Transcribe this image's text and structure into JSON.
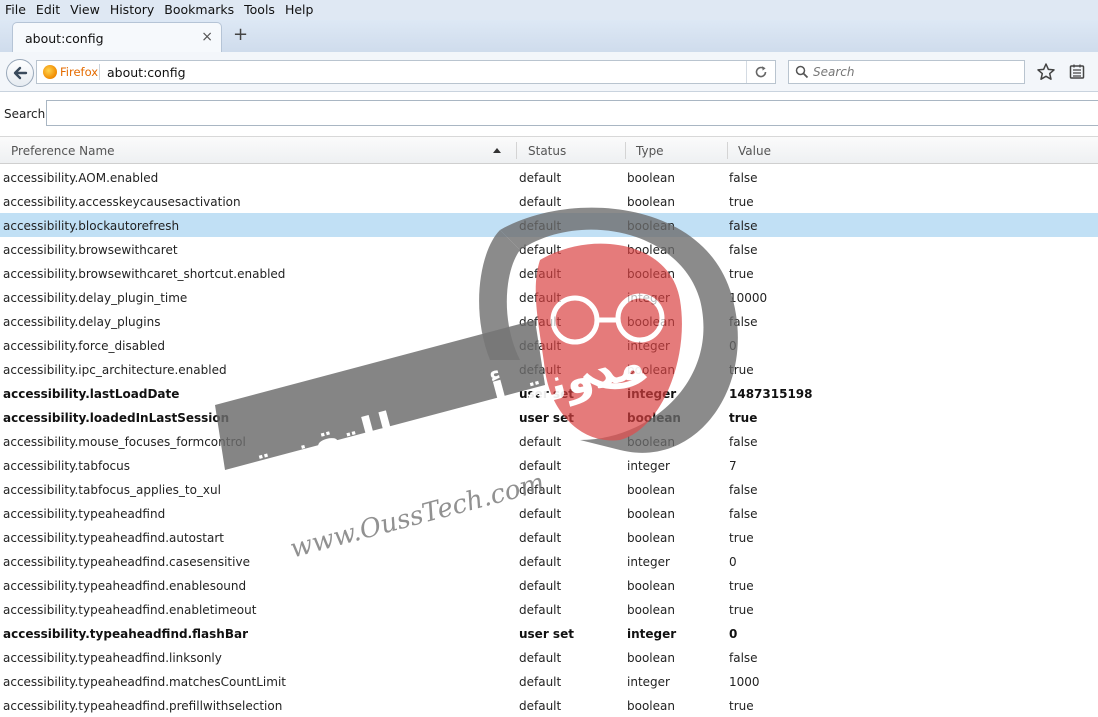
{
  "menu": [
    "File",
    "Edit",
    "View",
    "History",
    "Bookmarks",
    "Tools",
    "Help"
  ],
  "tab": {
    "title": "about:config",
    "close": "×",
    "new_tab": "+"
  },
  "navbar": {
    "identity_label": "Firefox",
    "url": "about:config",
    "search_placeholder": "Search"
  },
  "config_search": {
    "label": "Search:",
    "value": ""
  },
  "columns": {
    "name": "Preference Name",
    "status": "Status",
    "type": "Type",
    "value": "Value"
  },
  "rows": [
    {
      "name": "accessibility.AOM.enabled",
      "status": "default",
      "type": "boolean",
      "value": "false"
    },
    {
      "name": "accessibility.accesskeycausesactivation",
      "status": "default",
      "type": "boolean",
      "value": "true"
    },
    {
      "name": "accessibility.blockautorefresh",
      "status": "default",
      "type": "boolean",
      "value": "false"
    },
    {
      "name": "accessibility.browsewithcaret",
      "status": "default",
      "type": "boolean",
      "value": "false"
    },
    {
      "name": "accessibility.browsewithcaret_shortcut.enabled",
      "status": "default",
      "type": "boolean",
      "value": "true"
    },
    {
      "name": "accessibility.delay_plugin_time",
      "status": "default",
      "type": "integer",
      "value": "10000"
    },
    {
      "name": "accessibility.delay_plugins",
      "status": "default",
      "type": "boolean",
      "value": "false"
    },
    {
      "name": "accessibility.force_disabled",
      "status": "default",
      "type": "integer",
      "value": "0"
    },
    {
      "name": "accessibility.ipc_architecture.enabled",
      "status": "default",
      "type": "boolean",
      "value": "true"
    },
    {
      "name": "accessibility.lastLoadDate",
      "status": "user set",
      "type": "integer",
      "value": "1487315198"
    },
    {
      "name": "accessibility.loadedInLastSession",
      "status": "user set",
      "type": "boolean",
      "value": "true"
    },
    {
      "name": "accessibility.mouse_focuses_formcontrol",
      "status": "default",
      "type": "boolean",
      "value": "false"
    },
    {
      "name": "accessibility.tabfocus",
      "status": "default",
      "type": "integer",
      "value": "7"
    },
    {
      "name": "accessibility.tabfocus_applies_to_xul",
      "status": "default",
      "type": "boolean",
      "value": "false"
    },
    {
      "name": "accessibility.typeaheadfind",
      "status": "default",
      "type": "boolean",
      "value": "false"
    },
    {
      "name": "accessibility.typeaheadfind.autostart",
      "status": "default",
      "type": "boolean",
      "value": "true"
    },
    {
      "name": "accessibility.typeaheadfind.casesensitive",
      "status": "default",
      "type": "integer",
      "value": "0"
    },
    {
      "name": "accessibility.typeaheadfind.enablesound",
      "status": "default",
      "type": "boolean",
      "value": "true"
    },
    {
      "name": "accessibility.typeaheadfind.enabletimeout",
      "status": "default",
      "type": "boolean",
      "value": "true"
    },
    {
      "name": "accessibility.typeaheadfind.flashBar",
      "status": "user set",
      "type": "integer",
      "value": "0"
    },
    {
      "name": "accessibility.typeaheadfind.linksonly",
      "status": "default",
      "type": "boolean",
      "value": "false"
    },
    {
      "name": "accessibility.typeaheadfind.matchesCountLimit",
      "status": "default",
      "type": "integer",
      "value": "1000"
    },
    {
      "name": "accessibility.typeaheadfind.prefillwithselection",
      "status": "default",
      "type": "boolean",
      "value": "true"
    }
  ],
  "selected_row": 2,
  "watermark": {
    "arabic_text": "مدونة أوس للتقنية",
    "url_text": "www.OussTech.com"
  },
  "colors": {
    "selection": "#c1e0f5",
    "firefox_orange": "#e46b00",
    "watermark_red": "#d94040",
    "watermark_gray": "#6b6b6b"
  }
}
